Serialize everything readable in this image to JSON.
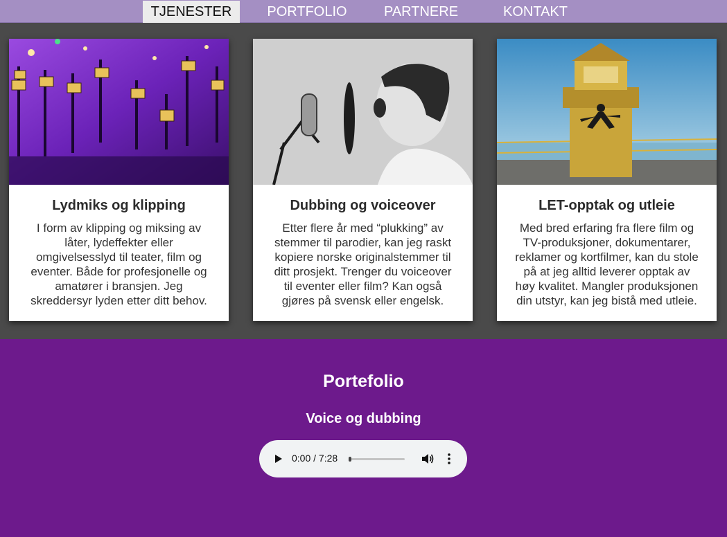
{
  "nav": {
    "items": [
      {
        "label": "TJENESTER",
        "active": true
      },
      {
        "label": "PORTFOLIO",
        "active": false
      },
      {
        "label": "PARTNERE",
        "active": false
      },
      {
        "label": "KONTAKT",
        "active": false
      }
    ]
  },
  "services": [
    {
      "image": "mixing-console-photo",
      "title": "Lydmiks og klipping",
      "text": "I form av klipping og miksing av låter, lydeffekter eller omgivelsesslyd til teater, film og eventer. Både for profesjonelle og amatører i bransjen. Jeg skreddersyr lyden etter ditt behov."
    },
    {
      "image": "boy-microphone-photo",
      "title": "Dubbing og voiceover",
      "text": "Etter flere år med “plukking” av stemmer til parodier, kan jeg raskt kopiere norske originalstemmer til ditt prosjekt. Trenger du voiceover til eventer eller film? Kan også gjøres på svensk eller engelsk."
    },
    {
      "image": "lighthouse-photo",
      "title": "LET-opptak og utleie",
      "text": "Med bred erfaring fra flere film og TV-produksjoner, dokumentarer, reklamer og kortfilmer, kan du stole på at jeg alltid leverer opptak av høy kvalitet. Mangler produksjonen din utstyr, kan jeg bistå med utleie."
    }
  ],
  "portfolio": {
    "title": "Portefolio",
    "subtitle": "Voice og dubbing",
    "audio": {
      "time": "0:00 / 7:28",
      "progress": 0
    }
  },
  "colors": {
    "nav_bg": "#a48fc3",
    "services_bg": "#4a4a4a",
    "portfolio_bg": "#6d1a8c",
    "nav_active_bg": "#ececec"
  }
}
